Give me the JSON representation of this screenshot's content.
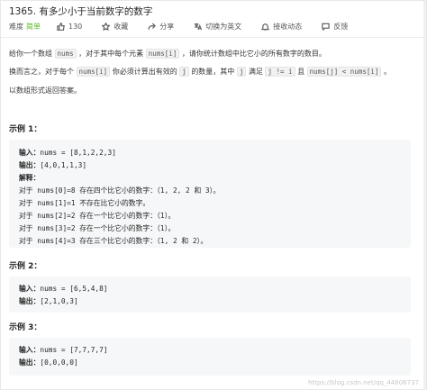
{
  "problem": {
    "title": "1365. 有多少小于当前数字的数字"
  },
  "toolbar": {
    "difficulty_label": "难度",
    "difficulty": "简单",
    "likes": "130",
    "favorite": "收藏",
    "share": "分享",
    "language": "切换为英文",
    "notify": "接收动态",
    "feedback": "反馈"
  },
  "description": {
    "p1_a": "给你一个数组",
    "p1_code": "nums",
    "p1_b": "，对于其中每个元素",
    "p1_code2": "nums[i]",
    "p1_c": "，请你统计数组中比它小的所有数字的数目。",
    "p2_a": "换而言之，对于每个",
    "p2_code": "nums[i]",
    "p2_b": "你必须计算出有效的",
    "p2_code2": "j",
    "p2_c": "的数量，其中",
    "p2_code3": "j",
    "p2_d": "满足",
    "p2_code4": "j != i",
    "p2_e": "且",
    "p2_code5": "nums[j] < nums[i]",
    "p2_f": "。",
    "p3": "以数组形式返回答案。"
  },
  "examples": [
    {
      "title": "示例 1：",
      "input_label": "输入：",
      "input": "nums = [8,1,2,2,3]",
      "output_label": "输出：",
      "output": "[4,0,1,1,3]",
      "explanation_label": "解释：",
      "explanation": [
        "对于 nums[0]=8 存在四个比它小的数字：（1, 2, 2 和 3）。",
        "对于 nums[1]=1 不存在比它小的数字。",
        "对于 nums[2]=2 存在一个比它小的数字：（1）。",
        "对于 nums[3]=2 存在一个比它小的数字：（1）。",
        "对于 nums[4]=3 存在三个比它小的数字：（1, 2 和 2）。"
      ]
    },
    {
      "title": "示例 2：",
      "input_label": "输入：",
      "input": "nums = [6,5,4,8]",
      "output_label": "输出：",
      "output": "[2,1,0,3]"
    },
    {
      "title": "示例 3：",
      "input_label": "输入：",
      "input": "nums = [7,7,7,7]",
      "output_label": "输出：",
      "output": "[0,0,0,0]"
    }
  ],
  "watermark": "https://blog.csdn.net/qq_44606737"
}
